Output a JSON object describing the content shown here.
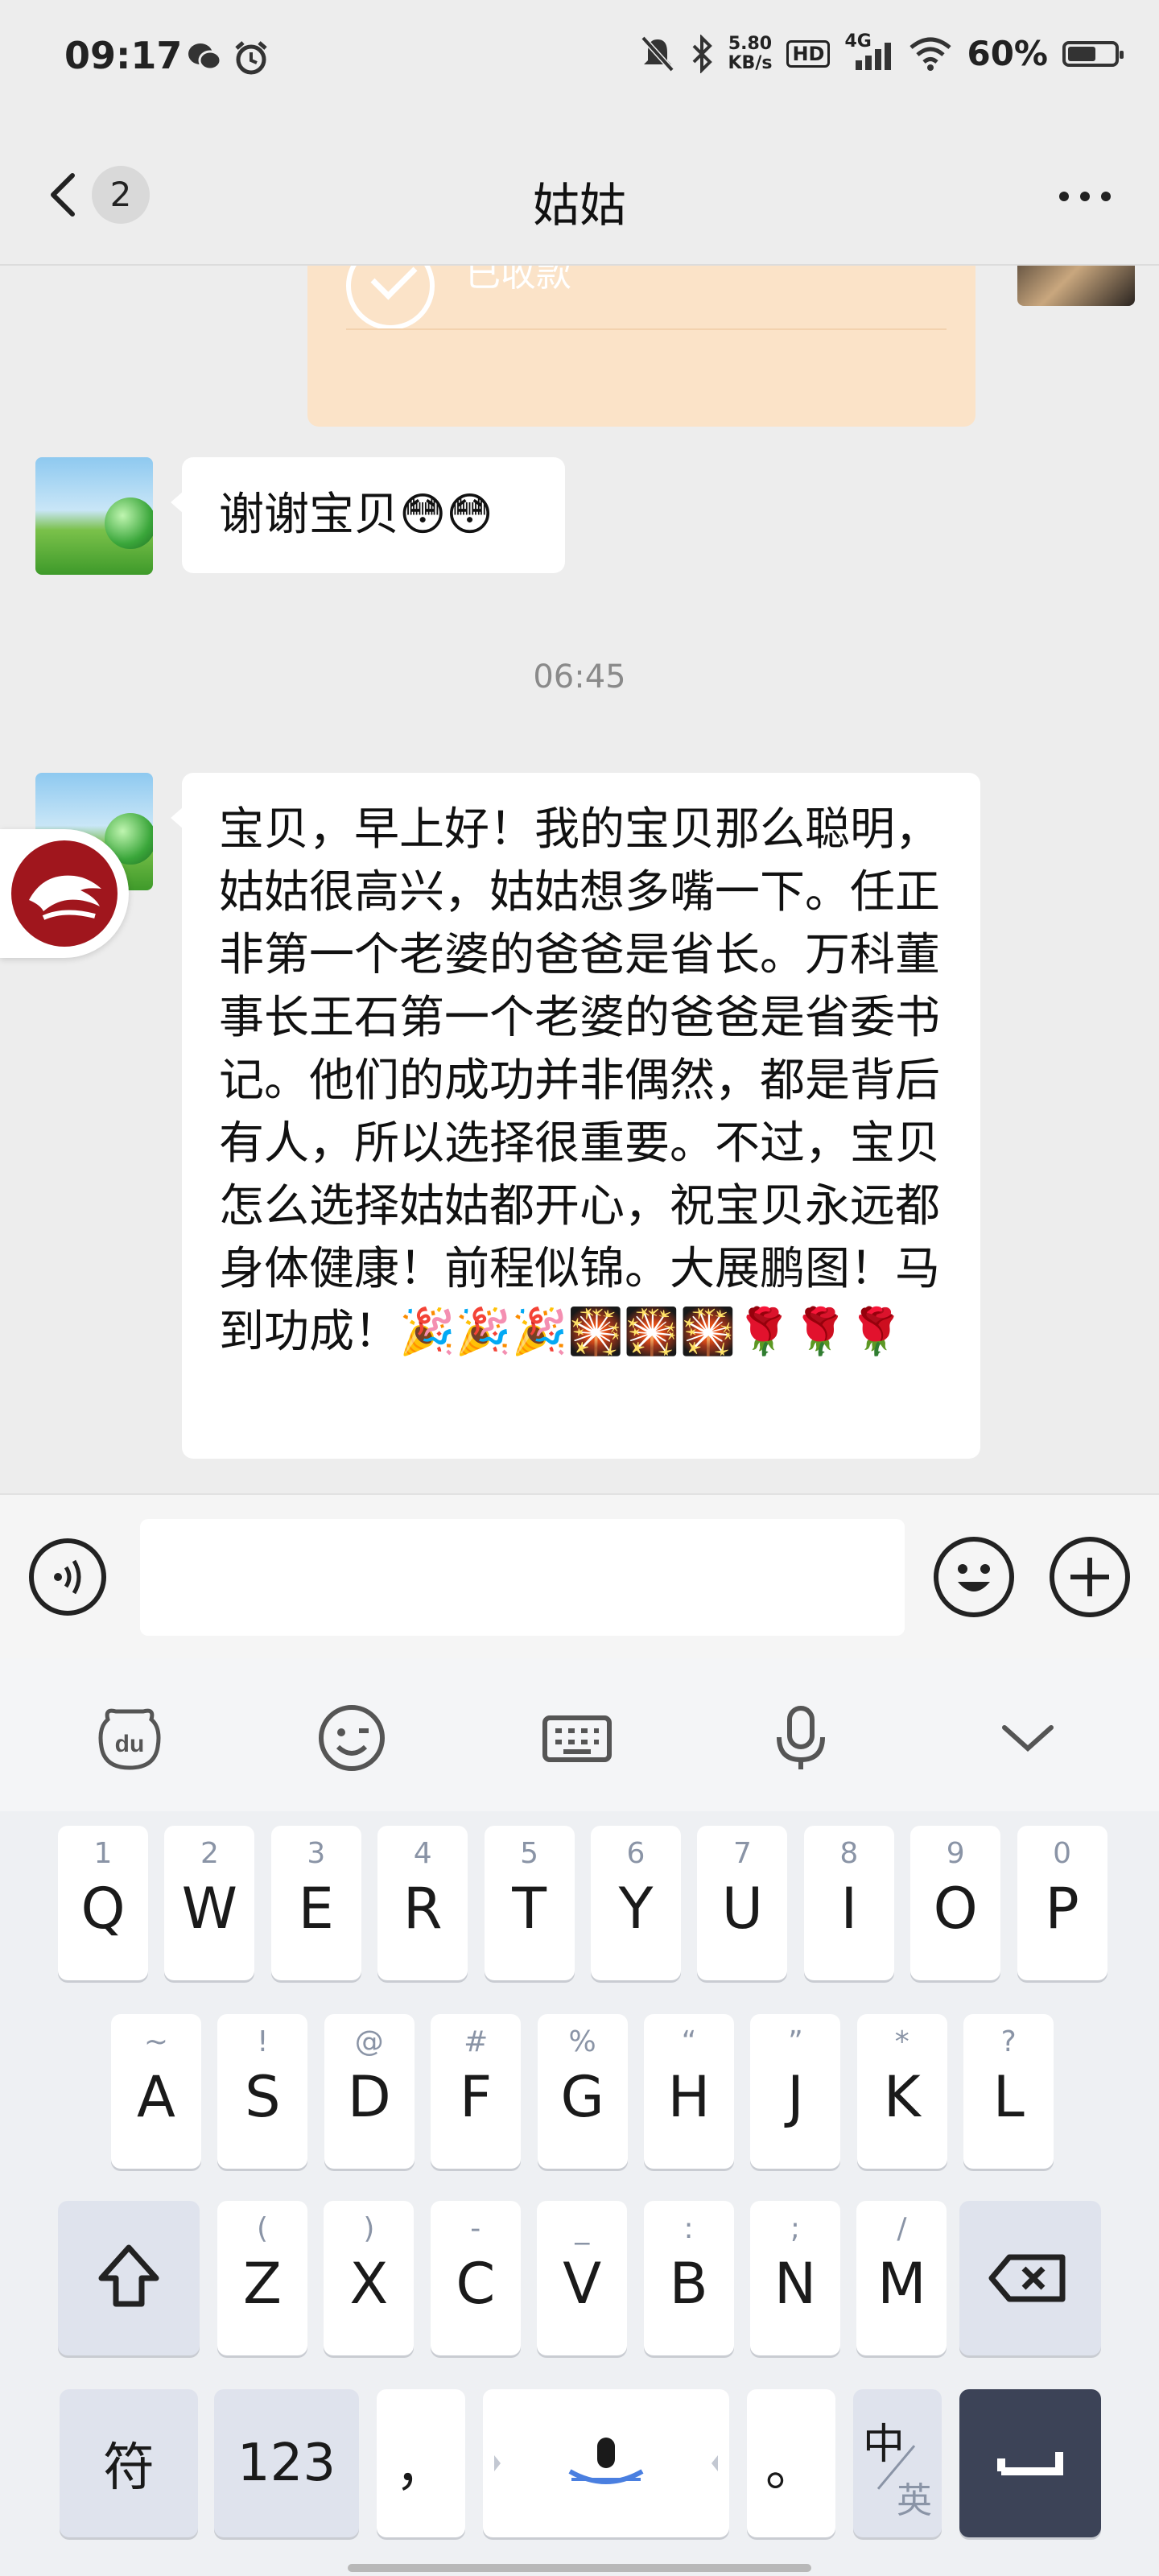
{
  "status_bar": {
    "time": "09:17",
    "net_speed_value": "5.80",
    "net_speed_unit": "KB/s",
    "hd_label": "HD",
    "network": "4G",
    "battery_percent": "60%",
    "battery_level": 0.6
  },
  "header": {
    "back_count": "2",
    "title": "姑姑"
  },
  "chat": {
    "transfer_status": "已收款",
    "message1": "谢谢宝贝😳😳",
    "timestamp": "06:45",
    "message2": "宝贝，早上好！我的宝贝那么聪明，姑姑很高兴，姑姑想多嘴一下。任正非第一个老婆的爸爸是省长。万科董事长王石第一个老婆的爸爸是省委书记。他们的成功并非偶然，都是背后有人，所以选择很重要。不过，宝贝怎么选择姑姑都开心，祝宝贝永远都身体健康！前程似锦。大展鹏图！马到功成！🎉🎉🎉🎇🎇🎇🌹🌹🌹"
  },
  "keyboard": {
    "row1": [
      {
        "hint": "1",
        "key": "Q"
      },
      {
        "hint": "2",
        "key": "W"
      },
      {
        "hint": "3",
        "key": "E"
      },
      {
        "hint": "4",
        "key": "R"
      },
      {
        "hint": "5",
        "key": "T"
      },
      {
        "hint": "6",
        "key": "Y"
      },
      {
        "hint": "7",
        "key": "U"
      },
      {
        "hint": "8",
        "key": "I"
      },
      {
        "hint": "9",
        "key": "O"
      },
      {
        "hint": "0",
        "key": "P"
      }
    ],
    "row2": [
      {
        "hint": "~",
        "key": "A"
      },
      {
        "hint": "!",
        "key": "S"
      },
      {
        "hint": "@",
        "key": "D"
      },
      {
        "hint": "#",
        "key": "F"
      },
      {
        "hint": "%",
        "key": "G"
      },
      {
        "hint": "“",
        "key": "H"
      },
      {
        "hint": "”",
        "key": "J"
      },
      {
        "hint": "*",
        "key": "K"
      },
      {
        "hint": "?",
        "key": "L"
      }
    ],
    "row3": [
      {
        "hint": "(",
        "key": "Z"
      },
      {
        "hint": ")",
        "key": "X"
      },
      {
        "hint": "-",
        "key": "C"
      },
      {
        "hint": "_",
        "key": "V"
      },
      {
        "hint": ":",
        "key": "B"
      },
      {
        "hint": ";",
        "key": "N"
      },
      {
        "hint": "/",
        "key": "M"
      }
    ],
    "symbols_key": "符",
    "numbers_key": "123",
    "comma_key": "，",
    "period_key": "。",
    "lang_key_top": "中",
    "lang_key_bottom": "英"
  },
  "colors": {
    "background": "#ededed",
    "bubble": "#ffffff",
    "transfer_card": "#fbe3c8",
    "enter_key": "#3c4357"
  }
}
